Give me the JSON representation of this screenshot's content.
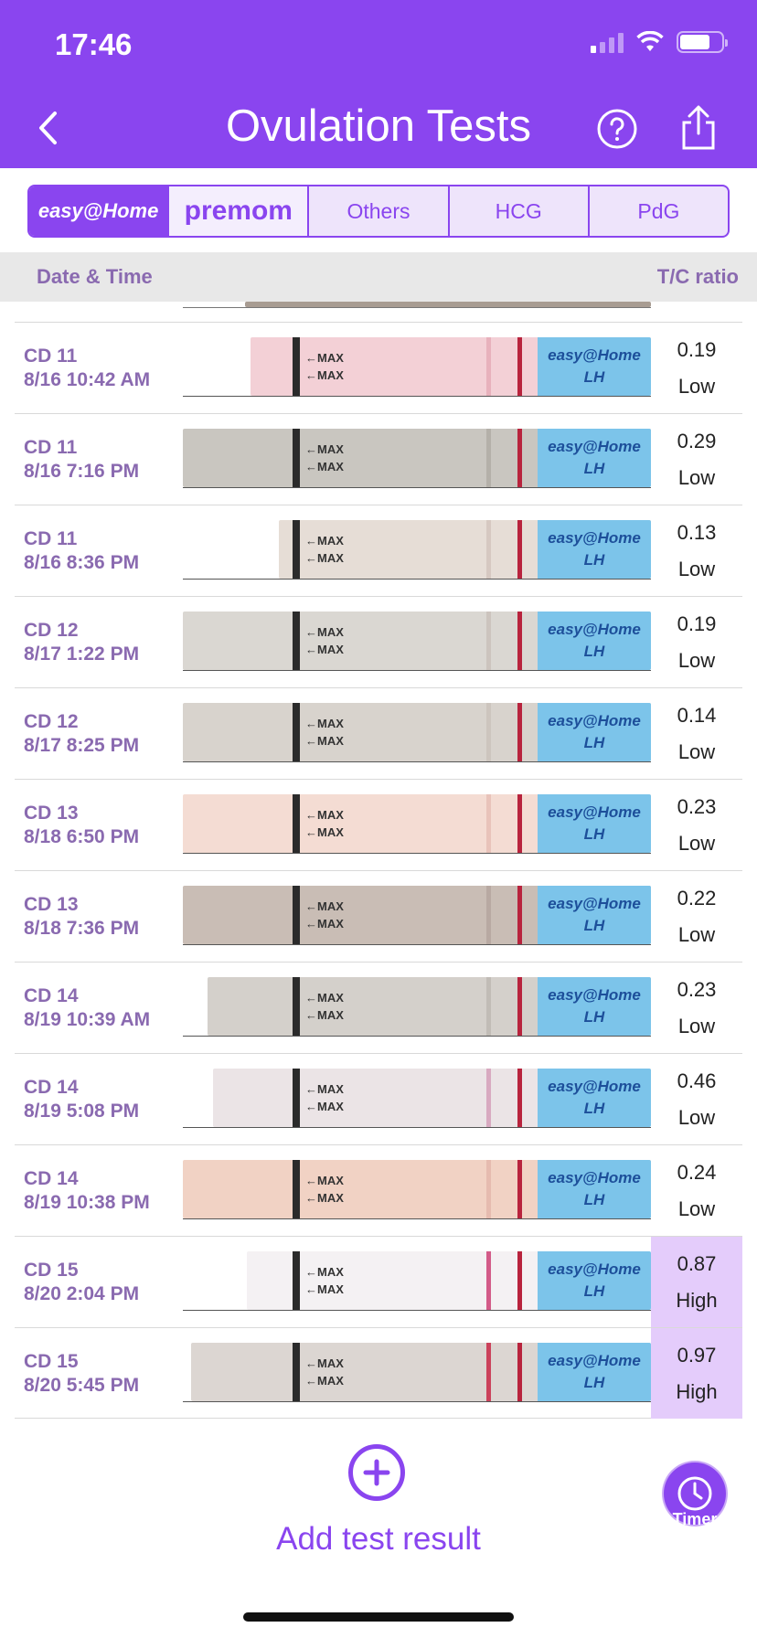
{
  "status_bar": {
    "time": "17:46"
  },
  "header": {
    "title": "Ovulation Tests"
  },
  "brand_tabs": [
    {
      "label": "easy@Home",
      "selected": true
    },
    {
      "label": "premom",
      "selected": false
    },
    {
      "label": "Others",
      "selected": false
    },
    {
      "label": "HCG",
      "selected": false
    },
    {
      "label": "PdG",
      "selected": false
    }
  ],
  "columns": {
    "date_time": "Date & Time",
    "ratio": "T/C ratio"
  },
  "strip_text": {
    "max": "←MAX",
    "brand": "easy@Home",
    "lh": "LH"
  },
  "rows": [
    {
      "cd": "CD 11",
      "datetime": "8/16 10:42 AM",
      "ratio": "0.19",
      "level": "Low",
      "high": false
    },
    {
      "cd": "CD 11",
      "datetime": "8/16 7:16 PM",
      "ratio": "0.29",
      "level": "Low",
      "high": false
    },
    {
      "cd": "CD 11",
      "datetime": "8/16 8:36 PM",
      "ratio": "0.13",
      "level": "Low",
      "high": false
    },
    {
      "cd": "CD 12",
      "datetime": "8/17 1:22 PM",
      "ratio": "0.19",
      "level": "Low",
      "high": false
    },
    {
      "cd": "CD 12",
      "datetime": "8/17 8:25 PM",
      "ratio": "0.14",
      "level": "Low",
      "high": false
    },
    {
      "cd": "CD 13",
      "datetime": "8/18 6:50 PM",
      "ratio": "0.23",
      "level": "Low",
      "high": false
    },
    {
      "cd": "CD 13",
      "datetime": "8/18 7:36 PM",
      "ratio": "0.22",
      "level": "Low",
      "high": false
    },
    {
      "cd": "CD 14",
      "datetime": "8/19 10:39 AM",
      "ratio": "0.23",
      "level": "Low",
      "high": false
    },
    {
      "cd": "CD 14",
      "datetime": "8/19 5:08 PM",
      "ratio": "0.46",
      "level": "Low",
      "high": false
    },
    {
      "cd": "CD 14",
      "datetime": "8/19 10:38 PM",
      "ratio": "0.24",
      "level": "Low",
      "high": false
    },
    {
      "cd": "CD 15",
      "datetime": "8/20 2:04 PM",
      "ratio": "0.87",
      "level": "High",
      "high": true
    },
    {
      "cd": "CD 15",
      "datetime": "8/20 5:45 PM",
      "ratio": "0.97",
      "level": "High",
      "high": true
    }
  ],
  "actions": {
    "add_label": "Add test result",
    "timer_label": "Timer"
  },
  "colors": {
    "accent": "#8a45ef",
    "high_bg": "#e4ccfb",
    "text_muted": "#8a6ab0"
  },
  "icons": [
    "back-chevron-icon",
    "help-icon",
    "share-icon",
    "plus-circle-icon",
    "timer-icon"
  ]
}
